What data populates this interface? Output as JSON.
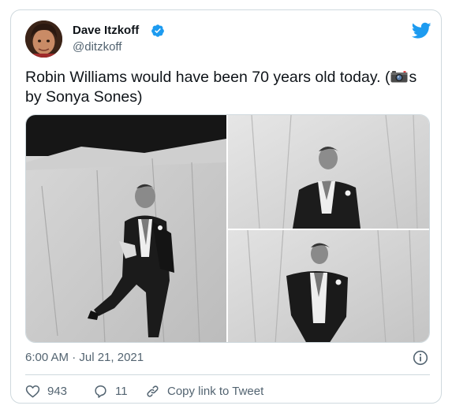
{
  "tweet": {
    "author": {
      "name": "Dave Itzkoff",
      "handle": "@ditzkoff",
      "verified": true,
      "avatar_icon": "profile-photo"
    },
    "text_before_icon": "Robin Williams would have been 70 years old today. (",
    "inline_icon": "camera-icon",
    "text_after_icon": "s by Sonya Sones)",
    "media": {
      "count": 3,
      "images": [
        {
          "description_icon": "photo-standing-leg-raised"
        },
        {
          "description_icon": "photo-waist-up-smiling"
        },
        {
          "description_icon": "photo-hands-in-pockets"
        }
      ]
    },
    "timestamp": "6:00 AM · Jul 21, 2021",
    "actions": {
      "likes": "943",
      "replies": "11",
      "copy_link_label": "Copy link to Tweet"
    }
  },
  "colors": {
    "brand": "#1d9bf0",
    "text_primary": "#0f1419",
    "text_secondary": "#536471",
    "border": "#cfd9de"
  }
}
